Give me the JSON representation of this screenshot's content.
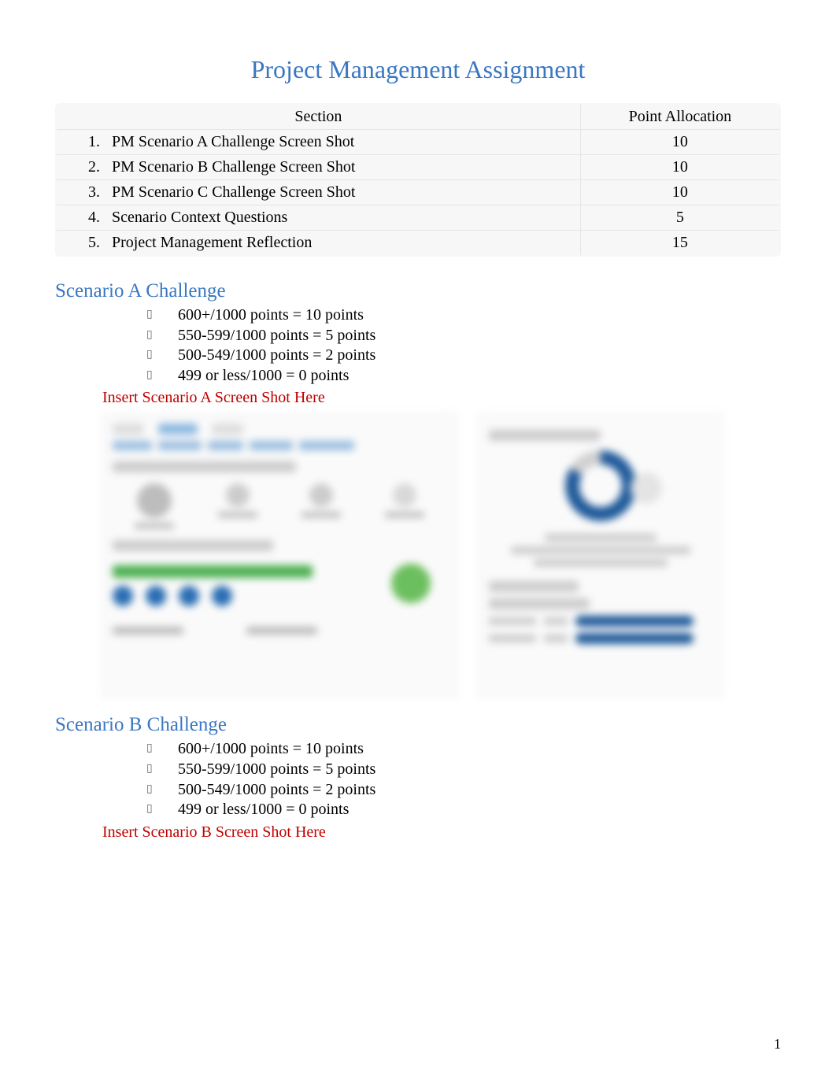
{
  "title": "Project Management Assignment",
  "table": {
    "headers": {
      "section": "Section",
      "points": "Point Allocation"
    },
    "rows": [
      {
        "n": "1.",
        "label": "PM Scenario A Challenge Screen Shot",
        "points": "10"
      },
      {
        "n": "2.",
        "label": "PM Scenario B Challenge Screen Shot",
        "points": "10"
      },
      {
        "n": "3.",
        "label": "PM Scenario C Challenge Screen Shot",
        "points": "10"
      },
      {
        "n": "4.",
        "label": "Scenario Context Questions",
        "points": "5"
      },
      {
        "n": "5.",
        "label": "Project Management Reflection",
        "points": "15"
      }
    ]
  },
  "scenarios": [
    {
      "heading": "Scenario A Challenge",
      "scoring": [
        "600+/1000 points = 10 points",
        "550-599/1000 points = 5 points",
        "500-549/1000 points = 2 points",
        "499 or less/1000 = 0 points"
      ],
      "insert": "Insert Scenario A Screen Shot Here"
    },
    {
      "heading": "Scenario B Challenge",
      "scoring": [
        "600+/1000 points = 10 points",
        "550-599/1000 points = 5 points",
        "500-549/1000 points = 2 points",
        "499 or less/1000 = 0 points"
      ],
      "insert": "Insert Scenario B Screen Shot Here"
    }
  ],
  "pageNumber": "1"
}
